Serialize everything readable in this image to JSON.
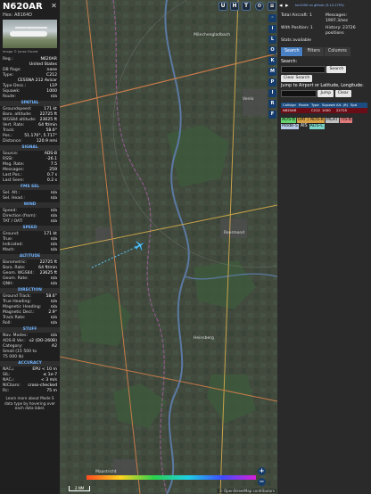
{
  "aircraft": {
    "callsign": "N620AR",
    "hex_label": "Hex:",
    "hex": "A8164D",
    "photo_credit": "Image © Jonas Forard"
  },
  "details": [
    {
      "k": "Reg.:",
      "v": "N620AR"
    },
    {
      "k": "",
      "v": "United States"
    },
    {
      "k": "DB flags:",
      "v": "none"
    },
    {
      "k": "Type:",
      "v": "C212"
    },
    {
      "k": "",
      "v": "CESSNA 212 Avicar"
    },
    {
      "k": "Type Desc.:",
      "v": "L1P"
    },
    {
      "k": "Squawk:",
      "v": "1000"
    },
    {
      "k": "Route:",
      "v": "n/a"
    }
  ],
  "sections": {
    "spatial": "SPATIAL",
    "signal": "SIGNAL",
    "fms_sel": "FMS SEL",
    "wind": "WIND",
    "speed": "SPEED",
    "altitude": "ALTITUDE",
    "direction": "DIRECTION",
    "stuff": "STUFF",
    "accuracy": "ACCURACY"
  },
  "spatial": [
    {
      "k": "Groundspeed:",
      "v": "171 kt"
    },
    {
      "k": "Baro. altitude:",
      "v": "22725 ft"
    },
    {
      "k": "WGS84 altitude:",
      "v": "23625 ft"
    },
    {
      "k": "Vert. Rate:",
      "v": "64 ft/min"
    },
    {
      "k": "Track:",
      "v": "58.6°"
    },
    {
      "k": "Pos.:",
      "v": "51.170°, 5.717°"
    },
    {
      "k": "Distance:",
      "v": "120.9 nmi"
    }
  ],
  "signal": [
    {
      "k": "Source:",
      "v": "ADS-B"
    },
    {
      "k": "RSSI:",
      "v": "-26.1"
    },
    {
      "k": "Msg. Rate:",
      "v": "7.5"
    },
    {
      "k": "Messages:",
      "v": "259"
    },
    {
      "k": "Last Pos.:",
      "v": "0.7 s"
    },
    {
      "k": "Last Seen:",
      "v": "0.2 s"
    }
  ],
  "fms": [
    {
      "k": "Sel. Alt.:",
      "v": "n/a"
    },
    {
      "k": "Sel. Head.:",
      "v": "n/a"
    }
  ],
  "wind": [
    {
      "k": "Speed:",
      "v": "n/a"
    },
    {
      "k": "Direction (from):",
      "v": "n/a"
    },
    {
      "k": "TAT / OAT:",
      "v": "n/a"
    }
  ],
  "speed": [
    {
      "k": "Ground:",
      "v": "171 kt"
    },
    {
      "k": "True:",
      "v": "n/a"
    },
    {
      "k": "Indicated:",
      "v": "n/a"
    },
    {
      "k": "Mach:",
      "v": "n/a"
    }
  ],
  "altitude": [
    {
      "k": "Barometric:",
      "v": "22725 ft"
    },
    {
      "k": "Baro. Rate:",
      "v": "64 ft/min"
    },
    {
      "k": "Geom. WGS84:",
      "v": "23625 ft"
    },
    {
      "k": "Geom. Rate:",
      "v": "n/a"
    },
    {
      "k": "QNH:",
      "v": "n/a"
    }
  ],
  "direction": [
    {
      "k": "Ground Track:",
      "v": "58.6°"
    },
    {
      "k": "True Heading:",
      "v": "n/a"
    },
    {
      "k": "Magnetic Heading:",
      "v": "n/a"
    },
    {
      "k": "Magnetic Decl.:",
      "v": "2.9°"
    },
    {
      "k": "Track Rate:",
      "v": "n/a"
    },
    {
      "k": "Roll:",
      "v": "n/a"
    }
  ],
  "stuff": [
    {
      "k": "Nav. Modes:",
      "v": "n/a"
    },
    {
      "k": "ADS-B Ver.:",
      "v": "v2 (DO-260B)"
    },
    {
      "k": "Category:",
      "v": "A2"
    },
    {
      "k": "Small (15 500 to",
      "v": ""
    },
    {
      "k": "75 000 lb)",
      "v": ""
    }
  ],
  "accuracy": [
    {
      "k": "NACₚ:",
      "v": "EPU < 10 m"
    },
    {
      "k": "SIL:",
      "v": "≤ 1e-7"
    },
    {
      "k": "NACᵥ:",
      "v": "< 3 m/s"
    },
    {
      "k": "NICbaro:",
      "v": "cross-checked"
    },
    {
      "k": "Rc:",
      "v": "75 m"
    }
  ],
  "footnote": "Learn more about Mode S data type by hovering over each data label.",
  "map": {
    "top_buttons": [
      "U",
      "H",
      "T"
    ],
    "side_buttons": [
      "L",
      "O",
      "K",
      "M",
      "P",
      "I",
      "R",
      "F"
    ],
    "scale_label": "2 NM",
    "attribution": "© OpenStreetMap contributors",
    "zoom_in": "+",
    "zoom_out": "−",
    "place_labels": [
      "Roermond",
      "Venlo",
      "Mönchengladbach",
      "Heinsberg",
      "Maastricht"
    ]
  },
  "right": {
    "link_text": "tar1090 on github (3.14.1793)",
    "total_label": "Total Aircraft:",
    "total_value": "1",
    "with_pos_label": "With Position:",
    "with_pos_value": "1",
    "stats_label": "Stats available",
    "messages_label": "Messages:",
    "messages_value": "1997.3/sec",
    "history_label": "History:",
    "history_value": "23726 positions",
    "tabs": [
      "Search",
      "Filters",
      "Columns"
    ],
    "search_label": "Search:",
    "search_button": "Search",
    "clear_search": "Clear Search",
    "jump_label": "Jump to Airport or Latitude, Longitude:",
    "jump_button": "Jump",
    "clear_button": "Clear",
    "table_headers": [
      "Callsign",
      "Route",
      "Type",
      "Squawk",
      "Alt. (ft)",
      "Spd"
    ],
    "table_row": [
      "N620AR",
      "",
      "C212",
      "1000",
      "22725",
      ""
    ],
    "legend": [
      {
        "label": "ADS-B",
        "color": "#66d36e"
      },
      {
        "label": "UAT / ADS-R",
        "color": "#d7a146"
      },
      {
        "label": "MLAT",
        "color": "#c0c0c0"
      },
      {
        "label": "TIS-B",
        "color": "#e07b7b"
      },
      {
        "label": "Mode-S",
        "color": "#b6c9e6"
      },
      {
        "label": "AIS",
        "color": "#2a2a2a"
      },
      {
        "label": "ADS-C",
        "color": "#7bd5c8"
      }
    ]
  },
  "colors": {
    "accent": "#4a80c4",
    "section_title": "#6fb3ff",
    "selected_row": "#6b0d17",
    "aircraft": "#59c7ff"
  }
}
